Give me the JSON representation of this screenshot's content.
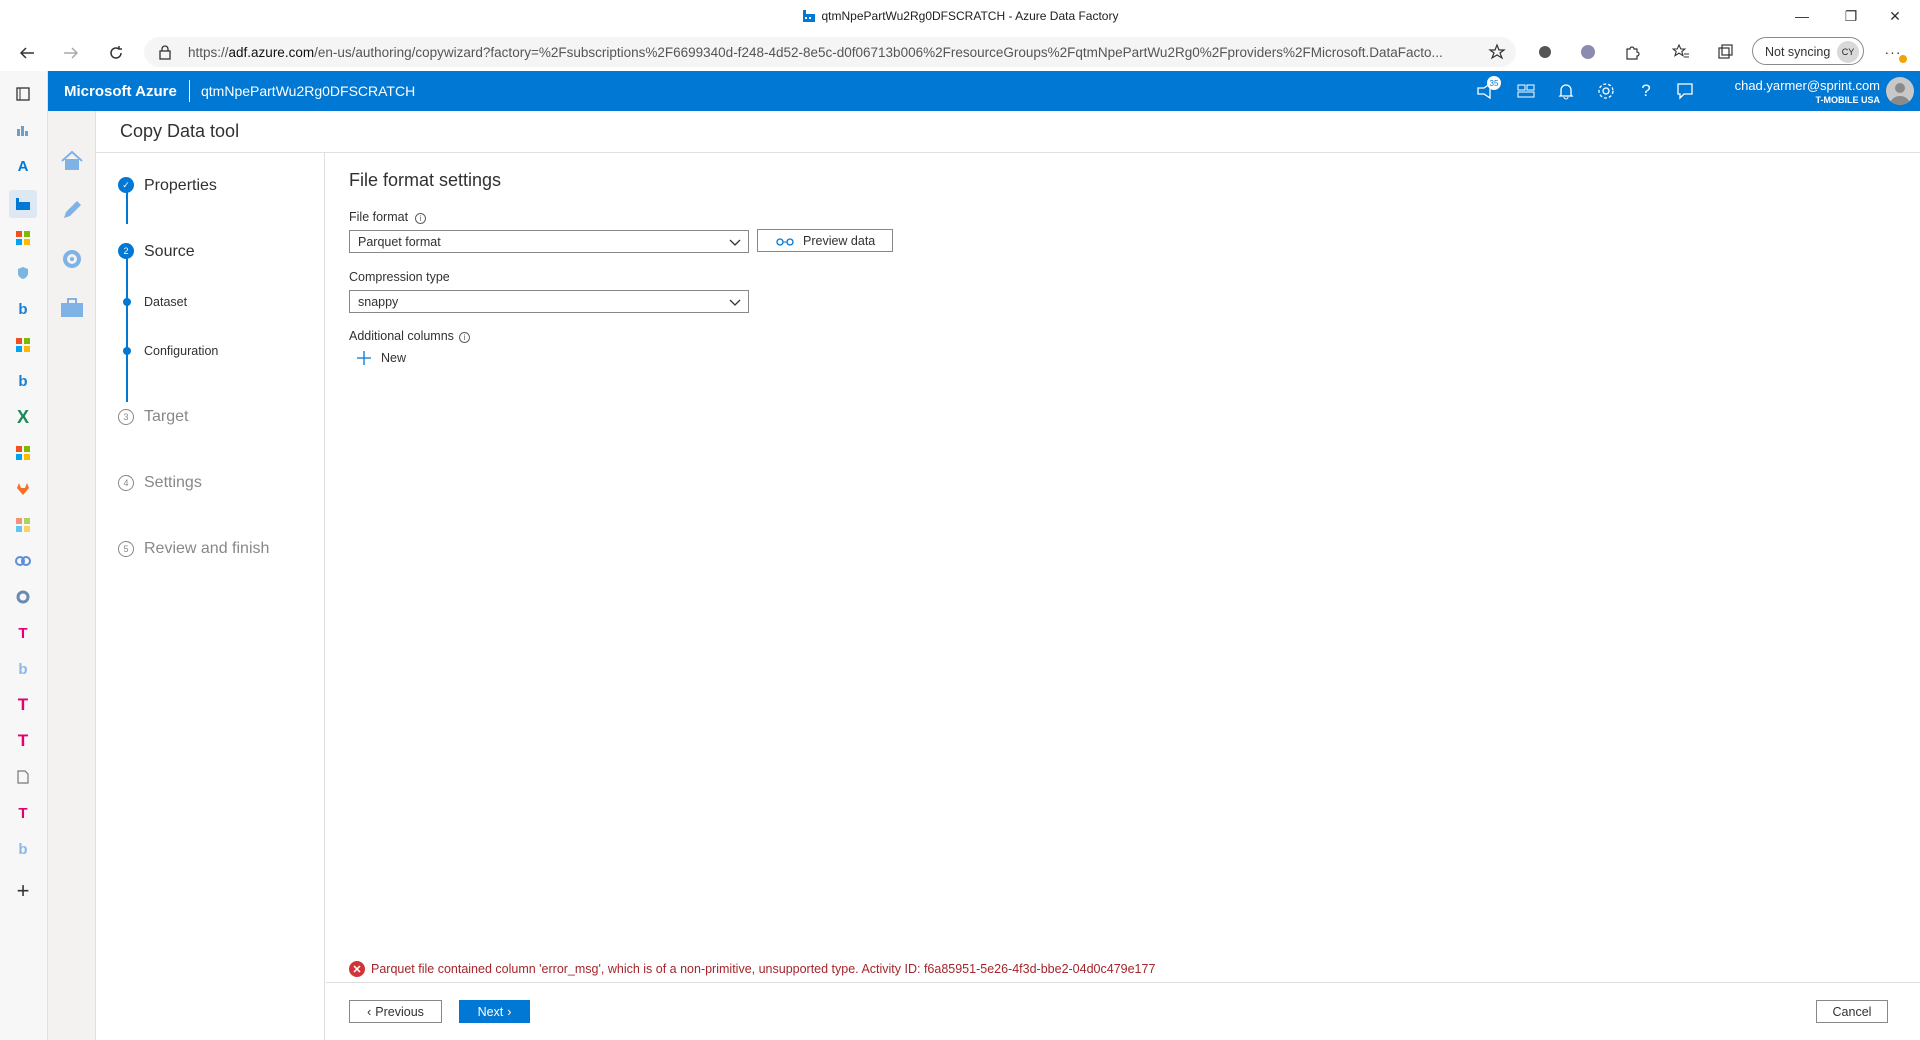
{
  "browser": {
    "window_title": "qtmNpePartWu2Rg0DFSCRATCH - Azure Data Factory",
    "url_prefix": "https://",
    "url_domain": "adf.azure.com",
    "url_rest": "/en-us/authoring/copywizard?factory=%2Fsubscriptions%2F6699340d-f248-4d52-8e5c-d0f06713b006%2FresourceGroups%2FqtmNpePartWu2Rg0%2Fproviders%2FMicrosoft.DataFacto...",
    "sync_label": "Not syncing",
    "profile_initials": "CY"
  },
  "azure_header": {
    "brand": "Microsoft Azure",
    "factory_name": "qtmNpePartWu2Rg0DFSCRATCH",
    "notification_count": "35",
    "user_email": "chad.yarmer@sprint.com",
    "user_org": "T-MOBILE USA"
  },
  "page": {
    "title": "Copy Data tool"
  },
  "steps": [
    {
      "label": "Properties",
      "number": "✓",
      "state": "complete"
    },
    {
      "label": "Source",
      "number": "2",
      "state": "active"
    },
    {
      "label": "Dataset",
      "state": "substep"
    },
    {
      "label": "Configuration",
      "state": "substep-current"
    },
    {
      "label": "Target",
      "number": "3",
      "state": "pending"
    },
    {
      "label": "Settings",
      "number": "4",
      "state": "pending"
    },
    {
      "label": "Review and finish",
      "number": "5",
      "state": "pending"
    }
  ],
  "form": {
    "heading": "File format settings",
    "file_format_label": "File format",
    "file_format_value": "Parquet format",
    "preview_button": "Preview data",
    "compression_label": "Compression type",
    "compression_value": "snappy",
    "additional_columns_label": "Additional columns",
    "new_button": "New"
  },
  "error": {
    "message": "Parquet file contained column 'error_msg', which is of a non-primitive, unsupported type. Activity ID: f6a85951-5e26-4f3d-bbe2-04d0c479e177"
  },
  "footer": {
    "previous": "Previous",
    "next": "Next",
    "cancel": "Cancel"
  },
  "colors": {
    "azure_blue": "#0078d4",
    "error_red": "#a4262c",
    "error_icon": "#d13438"
  },
  "icons": {
    "edge_sidebar": [
      "tabs-icon",
      "chart-icon",
      "azure-icon",
      "data-factory-icon",
      "microsoft-icon",
      "shield-icon",
      "bing-icon",
      "microsoft-icon",
      "bing-icon",
      "xbox-icon",
      "microsoft-icon",
      "gitlab-icon",
      "microsoft-icon",
      "link-icon",
      "circle-icon",
      "tmobile-icon",
      "bing-icon",
      "tmobile-icon",
      "tmobile-icon",
      "document-icon",
      "tmobile-icon",
      "bing-icon",
      "add-icon"
    ],
    "adf_nav": [
      "home-icon",
      "author-pencil-icon",
      "monitor-icon",
      "manage-toolbox-icon"
    ]
  }
}
